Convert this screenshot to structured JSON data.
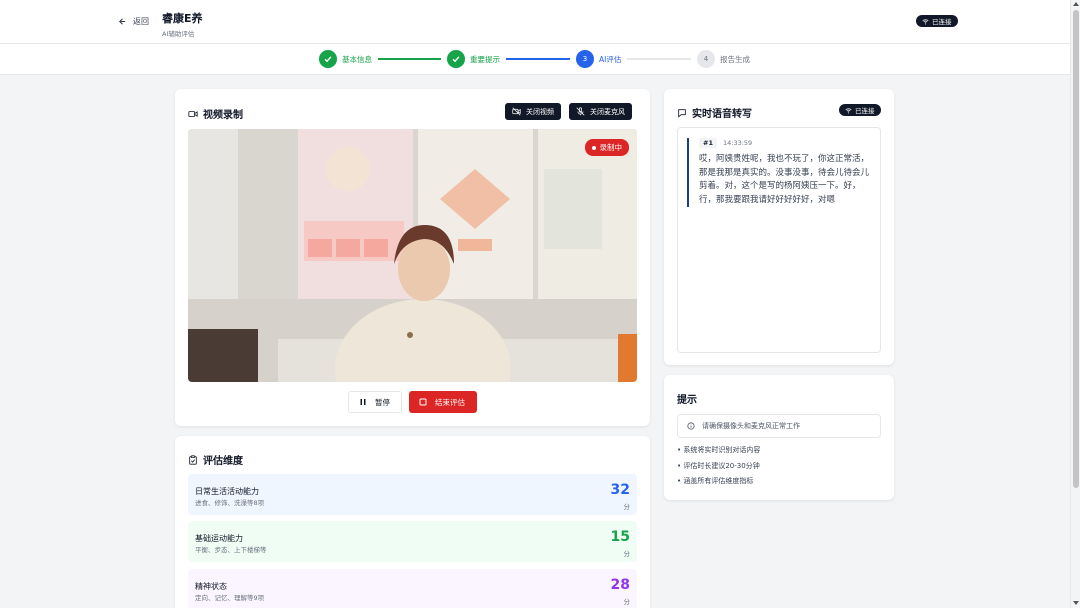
{
  "header": {
    "back_label": "返回",
    "title": "睿康E养",
    "subtitle": "AI辅助评估",
    "connection": "已连接"
  },
  "steps": [
    {
      "num": "1",
      "label": "基本信息",
      "state": "done"
    },
    {
      "num": "2",
      "label": "重要提示",
      "state": "done"
    },
    {
      "num": "3",
      "label": "AI评估",
      "state": "active"
    },
    {
      "num": "4",
      "label": "报告生成",
      "state": "todo"
    }
  ],
  "video_card": {
    "title": "视频录制",
    "close_video_label": "关闭视频",
    "close_mic_label": "关闭麦克风",
    "recording_label": "录制中",
    "pause_label": "暂停",
    "end_label": "结束评估"
  },
  "dimensions_card": {
    "title": "评估维度",
    "items": [
      {
        "name": "日常生活活动能力",
        "desc": "进食、修饰、洗澡等8项",
        "value": "32",
        "unit": "分",
        "color": "#2563eb",
        "bg": "#eff6ff"
      },
      {
        "name": "基础运动能力",
        "desc": "平衡、步态、上下楼梯等",
        "value": "15",
        "unit": "分",
        "color": "#16a34a",
        "bg": "#f0fdf4"
      },
      {
        "name": "精神状态",
        "desc": "定向、记忆、理解等9项",
        "value": "28",
        "unit": "分",
        "color": "#9333ea",
        "bg": "#faf5ff"
      }
    ]
  },
  "transcript_card": {
    "title": "实时语音转写",
    "connection": "已连接",
    "entries": [
      {
        "num": "#1",
        "time": "14:33:59",
        "text": "哎，阿姨贵姓呢，我也不玩了，你这正常活，那是我那是真实的。没事没事，待会儿待会儿剪着。对，这个是写的杨阿姨压一下。好，行，那我要跟我请好好好好好，对嗯"
      }
    ]
  },
  "tips_card": {
    "title": "提示",
    "notice": "请确保摄像头和麦克风正常工作",
    "items": [
      "• 系统将实时识别对话内容",
      "• 评估时长建议20-30分钟",
      "• 涵盖所有评估维度指标"
    ]
  }
}
